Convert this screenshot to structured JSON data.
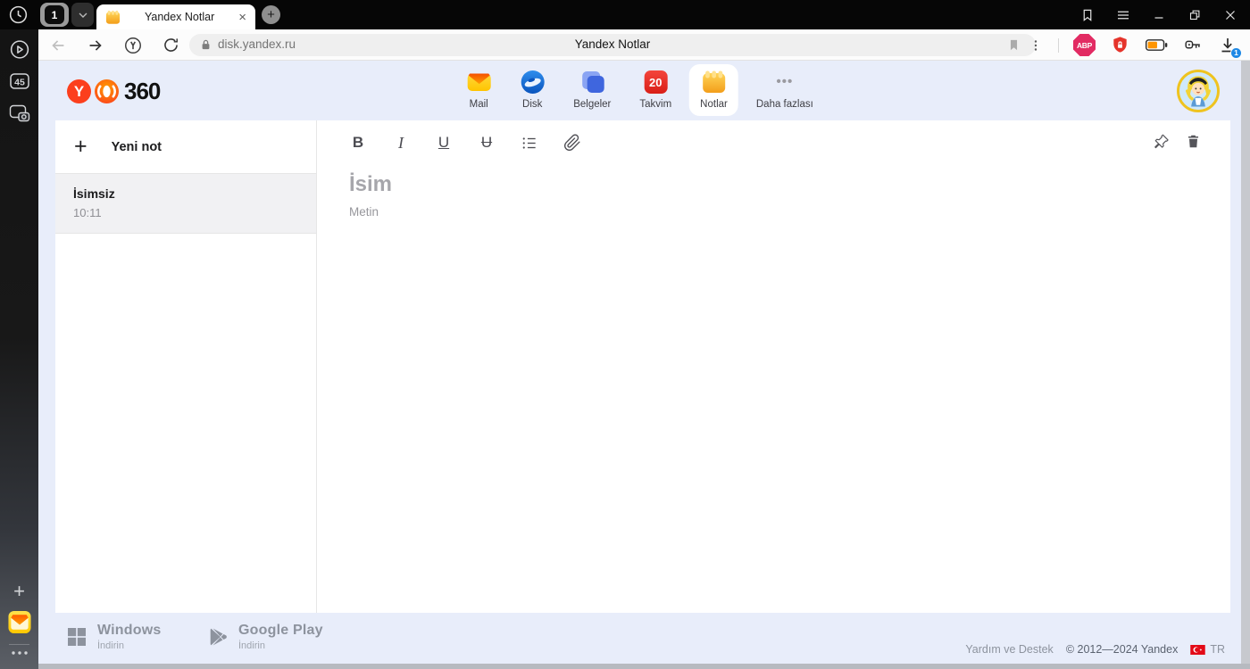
{
  "browser_chrome": {
    "tab_counter": "1",
    "tab_title": "Yandex Notlar",
    "tab_close": "×",
    "new_tab": "+",
    "url": "disk.yandex.ru",
    "page_title": "Yandex Notlar",
    "adblock_label": "ABP",
    "download_badge": "1"
  },
  "browser_sidebar": {
    "tabs_badge": "45"
  },
  "app_header": {
    "logo": {
      "y": "Y",
      "suffix": "360"
    },
    "nav": {
      "items": [
        {
          "label": "Mail"
        },
        {
          "label": "Disk"
        },
        {
          "label": "Belgeler"
        },
        {
          "label": "Takvim",
          "badge": "20"
        },
        {
          "label": "Notlar"
        },
        {
          "label": "Daha fazlası"
        }
      ]
    }
  },
  "notes_panel": {
    "new_note_label": "Yeni not",
    "plus": "+",
    "notes": [
      {
        "title": "İsimsiz",
        "time": "10:11"
      }
    ]
  },
  "editor": {
    "toolbar": {
      "bold": "B",
      "italic": "I",
      "underline": "U",
      "strikethrough": "U"
    },
    "title_placeholder": "İsim",
    "body_placeholder": "Metin"
  },
  "footer": {
    "windows_title": "Windows",
    "windows_subtitle": "İndirin",
    "gplay_title": "Google Play",
    "gplay_subtitle": "İndirin",
    "help_label": "Yardım ve Destek",
    "copyright": "© 2012—2024 Yandex",
    "locale_label": "TR"
  },
  "colors": {
    "page_bg": "#e8edfa",
    "logo_red": "#fc3f1d",
    "calendar_red": "#e5342b",
    "selected_note_bg": "#f1f1f3",
    "accent_blue_badge": "#1e88e5"
  }
}
